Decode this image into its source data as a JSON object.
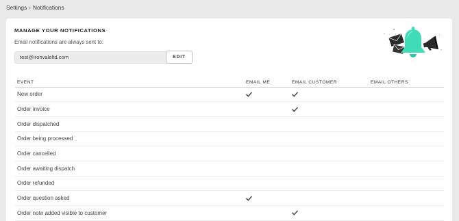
{
  "breadcrumb": {
    "parent": "Settings",
    "separator": "›",
    "current": "Notifications"
  },
  "card": {
    "title": "MANAGE YOUR NOTIFICATIONS",
    "subtitle": "Email notifications are always sent to:",
    "email_value": "test@ironvaleltd.com",
    "edit_label": "EDIT"
  },
  "illustration": {
    "icon": "notification-bell-illustration",
    "bell_color": "#3fdcb7"
  },
  "table": {
    "columns": [
      "EVENT",
      "EMAIL ME",
      "EMAIL CUSTOMER",
      "EMAIL OTHERS"
    ],
    "rows": [
      {
        "event": "New order",
        "email_me": true,
        "email_customer": true,
        "email_others": false
      },
      {
        "event": "Order invoice",
        "email_me": false,
        "email_customer": true,
        "email_others": false
      },
      {
        "event": "Order dispatched",
        "email_me": false,
        "email_customer": false,
        "email_others": false
      },
      {
        "event": "Order being processed",
        "email_me": false,
        "email_customer": false,
        "email_others": false
      },
      {
        "event": "Order cancelled",
        "email_me": false,
        "email_customer": false,
        "email_others": false
      },
      {
        "event": "Order awaiting dispatch",
        "email_me": false,
        "email_customer": false,
        "email_others": false
      },
      {
        "event": "Order refunded",
        "email_me": false,
        "email_customer": false,
        "email_others": false
      },
      {
        "event": "Order question asked",
        "email_me": true,
        "email_customer": false,
        "email_others": false
      },
      {
        "event": "Order note added visible to customer",
        "email_me": false,
        "email_customer": true,
        "email_others": false
      }
    ]
  }
}
